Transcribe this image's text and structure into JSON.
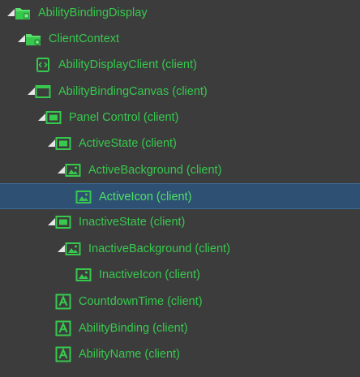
{
  "hierarchy": {
    "items": [
      {
        "label": "AbilityBindingDisplay",
        "icon": "folder-group-icon",
        "expanded": true
      },
      {
        "label": "ClientContext",
        "icon": "folder-context-icon",
        "expanded": true
      },
      {
        "label": "AbilityDisplayClient (client)",
        "icon": "script-icon",
        "expanded": null
      },
      {
        "label": "AbilityBindingCanvas (client)",
        "icon": "canvas-icon",
        "expanded": true
      },
      {
        "label": "Panel Control (client)",
        "icon": "panel-icon",
        "expanded": true
      },
      {
        "label": "ActiveState (client)",
        "icon": "panel-icon",
        "expanded": true
      },
      {
        "label": "ActiveBackground (client)",
        "icon": "image-icon",
        "expanded": true
      },
      {
        "label": "ActiveIcon (client)",
        "icon": "image-icon",
        "expanded": null,
        "selected": true
      },
      {
        "label": "InactiveState (client)",
        "icon": "panel-icon",
        "expanded": true
      },
      {
        "label": "InactiveBackground (client)",
        "icon": "image-icon",
        "expanded": true
      },
      {
        "label": "InactiveIcon (client)",
        "icon": "image-icon",
        "expanded": null
      },
      {
        "label": "CountdownTime (client)",
        "icon": "text-icon",
        "expanded": null
      },
      {
        "label": "AbilityBinding (client)",
        "icon": "text-icon",
        "expanded": null
      },
      {
        "label": "AbilityName (client)",
        "icon": "text-icon",
        "expanded": null
      }
    ]
  },
  "colors": {
    "background": "#3c3c3c",
    "text": "#37c94e",
    "selection": "#2e5173",
    "arrow": "#e6e6e6"
  }
}
